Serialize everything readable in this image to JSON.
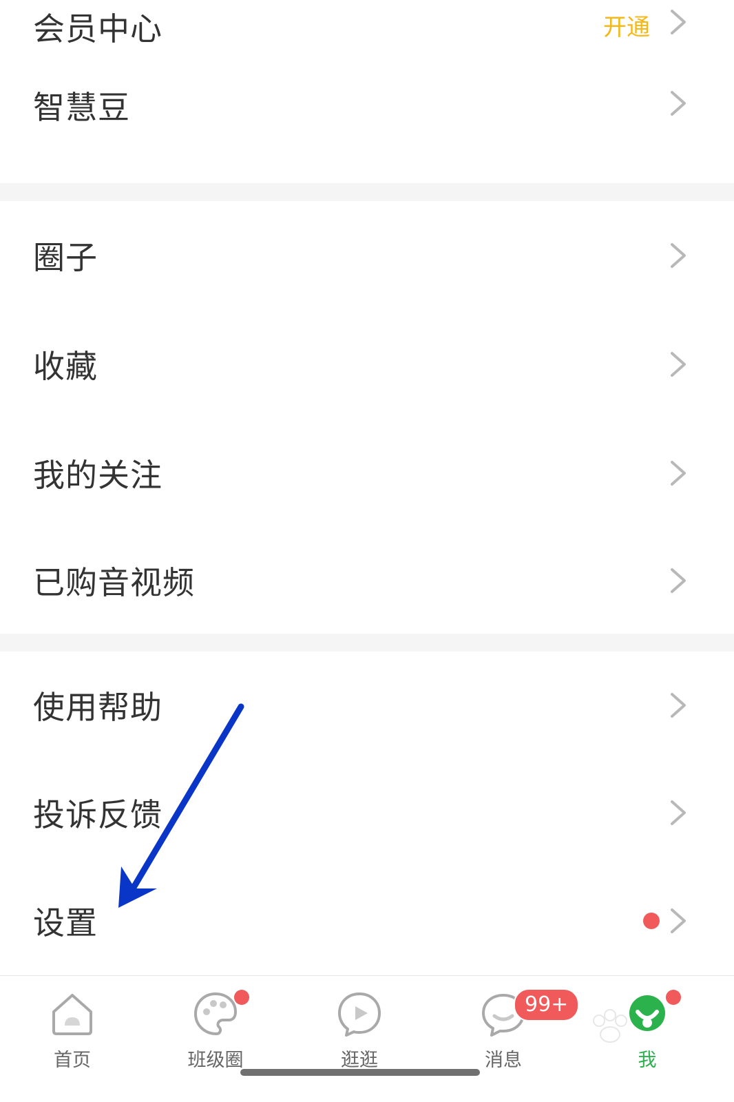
{
  "menu_group1": {
    "vip_label": "会员中心",
    "vip_action": "开通",
    "beans_label": "智慧豆"
  },
  "menu_group2": {
    "items": [
      {
        "label": "圈子"
      },
      {
        "label": "收藏"
      },
      {
        "label": "我的关注"
      },
      {
        "label": "已购音视频"
      }
    ]
  },
  "menu_group3": {
    "items": [
      {
        "label": "使用帮助"
      },
      {
        "label": "投诉反馈"
      },
      {
        "label": "设置"
      }
    ]
  },
  "tabbar": {
    "tabs": [
      {
        "label": "首页",
        "icon": "home-icon"
      },
      {
        "label": "班级圈",
        "icon": "palette-icon"
      },
      {
        "label": "逛逛",
        "icon": "play-bubble-icon"
      },
      {
        "label": "消息",
        "icon": "chat-icon",
        "badge": "99+"
      },
      {
        "label": "我",
        "icon": "profile-icon"
      }
    ]
  },
  "colors": {
    "accent_yellow": "#f5b81b",
    "active_green": "#2bb24c",
    "badge_red": "#f05a5a",
    "annotation_arrow": "#0a36c8"
  }
}
